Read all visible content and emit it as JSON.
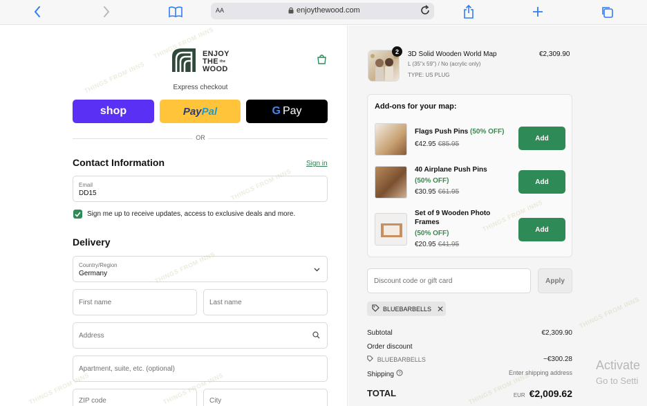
{
  "browser": {
    "text_size_label": "AA",
    "domain": "enjoythewood.com"
  },
  "store": {
    "logo_line1": "ENJOY",
    "logo_line2": "THE",
    "logo_the_small": "the",
    "logo_line3": "WOOD"
  },
  "express": {
    "label": "Express checkout",
    "shop_label": "shop",
    "paypal_label_1": "Pay",
    "paypal_label_2": "Pal",
    "gpay_g": "G",
    "gpay_label": "Pay",
    "or_label": "OR"
  },
  "contact": {
    "heading": "Contact Information",
    "signin_label": "Sign in",
    "email_label": "Email",
    "email_value": "DD15",
    "newsletter_label": "Sign me up to receive updates, access to exclusive deals and more."
  },
  "delivery": {
    "heading": "Delivery",
    "country_label": "Country/Region",
    "country_value": "Germany",
    "first_name_placeholder": "First name",
    "last_name_placeholder": "Last name",
    "address_placeholder": "Address",
    "apartment_placeholder": "Apartment, suite, etc. (optional)",
    "zip_placeholder": "ZIP code",
    "city_placeholder": "City"
  },
  "cart": {
    "item": {
      "quantity": "2",
      "name": "3D Solid Wooden World Map",
      "variant": "L (35\"x 59\") / No (acrylic only)",
      "type": "TYPE: US PLUG",
      "price": "€2,309.90"
    }
  },
  "addons": {
    "title": "Add-ons for your map:",
    "items": [
      {
        "name": "Flags Push Pins",
        "off": "(50% OFF)",
        "price": "€42.95",
        "old_price": "€85.95",
        "button": "Add"
      },
      {
        "name": "40 Airplane Push Pins",
        "off": "(50% OFF)",
        "price": "€30.95",
        "old_price": "€61.95",
        "button": "Add"
      },
      {
        "name": "Set of 9 Wooden Photo Frames",
        "off": "(50% OFF)",
        "price": "€20.95",
        "old_price": "€41.95",
        "button": "Add"
      }
    ]
  },
  "discount": {
    "placeholder": "Discount code or gift card",
    "apply_label": "Apply",
    "applied_code": "BLUEBARBELLS",
    "remove_symbol": "✕"
  },
  "summary": {
    "subtotal_label": "Subtotal",
    "subtotal_value": "€2,309.90",
    "order_discount_label": "Order discount",
    "discount_code": "BLUEBARBELLS",
    "discount_value": "−€300.28",
    "shipping_label": "Shipping",
    "shipping_value": "Enter shipping address",
    "total_label": "TOTAL",
    "total_currency": "EUR",
    "total_value": "€2,009.62"
  },
  "overlay": {
    "activate_line1": "Activate",
    "activate_line2": "Go to Setti",
    "watermark": "THINGS FROM INNS"
  },
  "colors": {
    "accent_green": "#2e8b57",
    "shop_purple": "#5a31f4",
    "paypal_yellow": "#ffc439",
    "safari_blue": "#2f7cf6"
  }
}
